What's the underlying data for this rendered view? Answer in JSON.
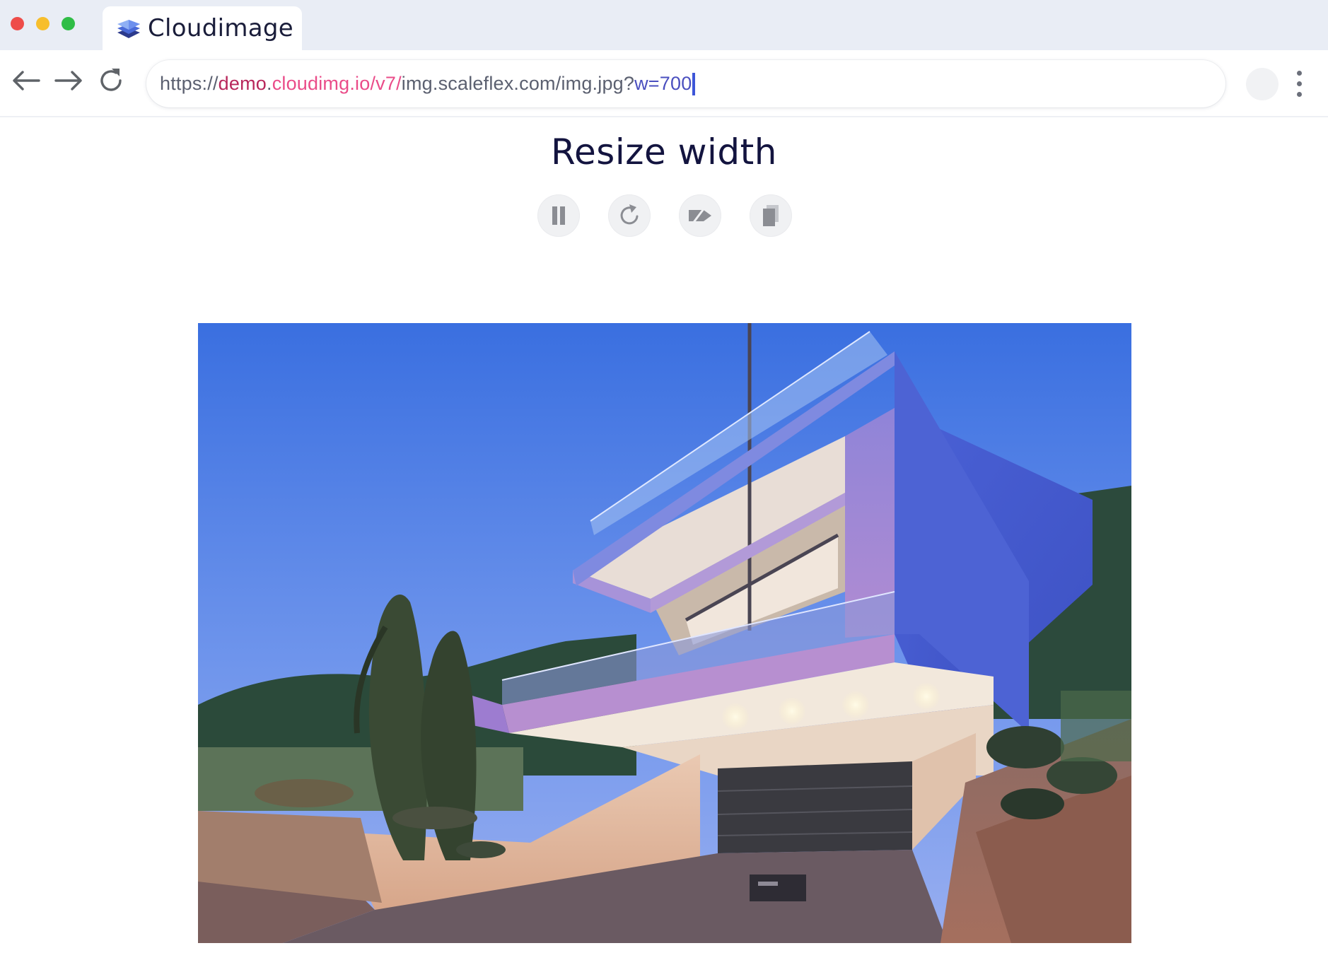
{
  "browser": {
    "tab_title": "Cloudimage",
    "url": {
      "protocol": "https://",
      "host_demo": "demo",
      "host_dot": ".",
      "host_rest": "cloudimg.io/v7/",
      "path": "img.scaleflex.com/img.jpg?",
      "param": "w=700"
    }
  },
  "page": {
    "title": "Resize width",
    "controls": [
      {
        "name": "pause",
        "icon": "pause-icon"
      },
      {
        "name": "replay",
        "icon": "replay-icon"
      },
      {
        "name": "compare",
        "icon": "compare-icon"
      },
      {
        "name": "copy",
        "icon": "copy-icon"
      }
    ],
    "image": {
      "subject": "modern-house-photo"
    }
  },
  "colors": {
    "url_demo": "#b8275b",
    "url_cloudimg": "#ea4c89",
    "url_param": "#4a4fbf",
    "title": "#13143f"
  }
}
